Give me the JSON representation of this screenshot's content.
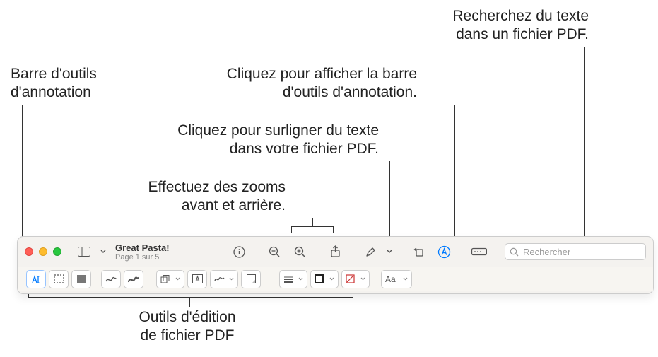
{
  "callouts": {
    "search": "Recherchez du texte\ndans un fichier PDF.",
    "annot_toolbar_lbl": "Barre d'outils\nd'annotation",
    "show_annot": "Cliquez pour afficher la barre\nd'outils d'annotation.",
    "highlight": "Cliquez pour surligner du texte\ndans votre fichier PDF.",
    "zoom": "Effectuez des zooms\navant et arrière.",
    "edit_tools": "Outils d'édition\nde fichier PDF"
  },
  "window": {
    "title": "Great Pasta!",
    "subtitle": "Page 1 sur 5",
    "search_placeholder": "Rechercher"
  },
  "colors": {
    "accent": "#007aff"
  }
}
